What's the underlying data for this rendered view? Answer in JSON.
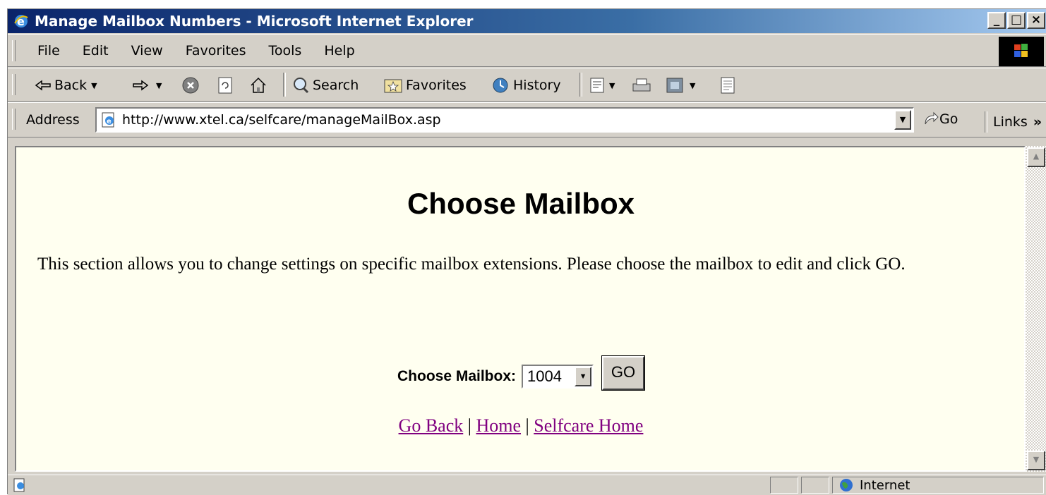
{
  "window": {
    "title": "Manage Mailbox Numbers - Microsoft Internet Explorer",
    "controls": [
      "_",
      "□",
      "×"
    ]
  },
  "menu": [
    "File",
    "Edit",
    "View",
    "Favorites",
    "Tools",
    "Help"
  ],
  "toolbar": {
    "back": "Back",
    "search": "Search",
    "favorites": "Favorites",
    "history": "History"
  },
  "address": {
    "label": "Address",
    "url": "http://www.xtel.ca/selfcare/manageMailBox.asp",
    "go": "Go",
    "links": "Links",
    "links_more": "»"
  },
  "page": {
    "heading": "Choose Mailbox",
    "description": "This section allows you to change settings on specific mailbox extensions. Please choose the mailbox to edit and click GO.",
    "form": {
      "label": "Choose Mailbox:",
      "selected": "1004",
      "submit": "GO"
    },
    "links": {
      "go_back": "Go Back",
      "home": "Home",
      "selfcare_home": "Selfcare Home",
      "separator": "|"
    }
  },
  "status": {
    "zone": "Internet"
  },
  "icons": {
    "app": "ie-icon",
    "back": "back-arrow-icon",
    "forward": "forward-arrow-icon",
    "stop": "stop-icon",
    "refresh": "refresh-icon",
    "home": "home-icon",
    "search": "search-icon",
    "favorites": "favorites-icon",
    "history": "history-icon",
    "mail": "mail-icon",
    "print": "print-icon",
    "edit": "edit-icon",
    "discuss": "discuss-icon",
    "page": "page-icon",
    "go": "go-arrow-icon",
    "zone": "globe-icon"
  }
}
